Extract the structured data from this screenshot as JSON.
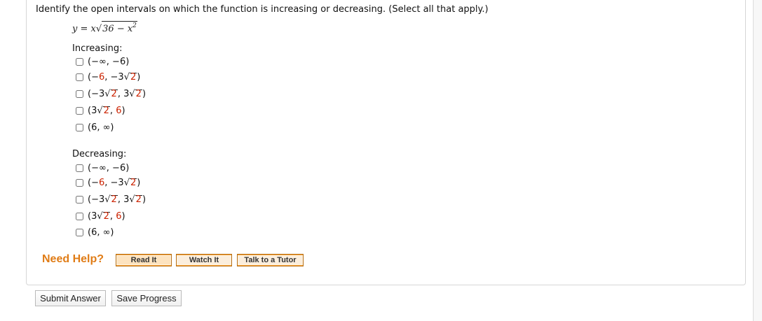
{
  "question": {
    "prompt": "Identify the open intervals on which the function is increasing or decreasing. (Select all that apply.)",
    "formula": {
      "lhs": "y = x",
      "radicand": "36 − x",
      "exp": "2"
    }
  },
  "increasing": {
    "label": "Increasing:",
    "options": [
      {
        "checked": false
      },
      {
        "checked": false
      },
      {
        "checked": false
      },
      {
        "checked": false
      },
      {
        "checked": false
      }
    ]
  },
  "decreasing": {
    "label": "Decreasing:",
    "options": [
      {
        "checked": false
      },
      {
        "checked": false
      },
      {
        "checked": false
      },
      {
        "checked": false
      },
      {
        "checked": false
      }
    ]
  },
  "intervals": {
    "o1": {
      "a": "(−∞, −6)"
    },
    "o2": {
      "a": "(−6, −3",
      "rad": "2",
      "b": ")"
    },
    "o3": {
      "a": "(−3",
      "rad1": "2",
      "mid": ", 3",
      "rad2": "2",
      "b": ")"
    },
    "o4": {
      "a": "(3",
      "rad": "2",
      "b": ", 6)"
    },
    "o5": {
      "a": "(6, ∞)"
    }
  },
  "help": {
    "label": "Need Help?",
    "read": "Read It",
    "watch": "Watch It",
    "tutor": "Talk to a Tutor"
  },
  "actions": {
    "submit": "Submit Answer",
    "save": "Save Progress"
  }
}
